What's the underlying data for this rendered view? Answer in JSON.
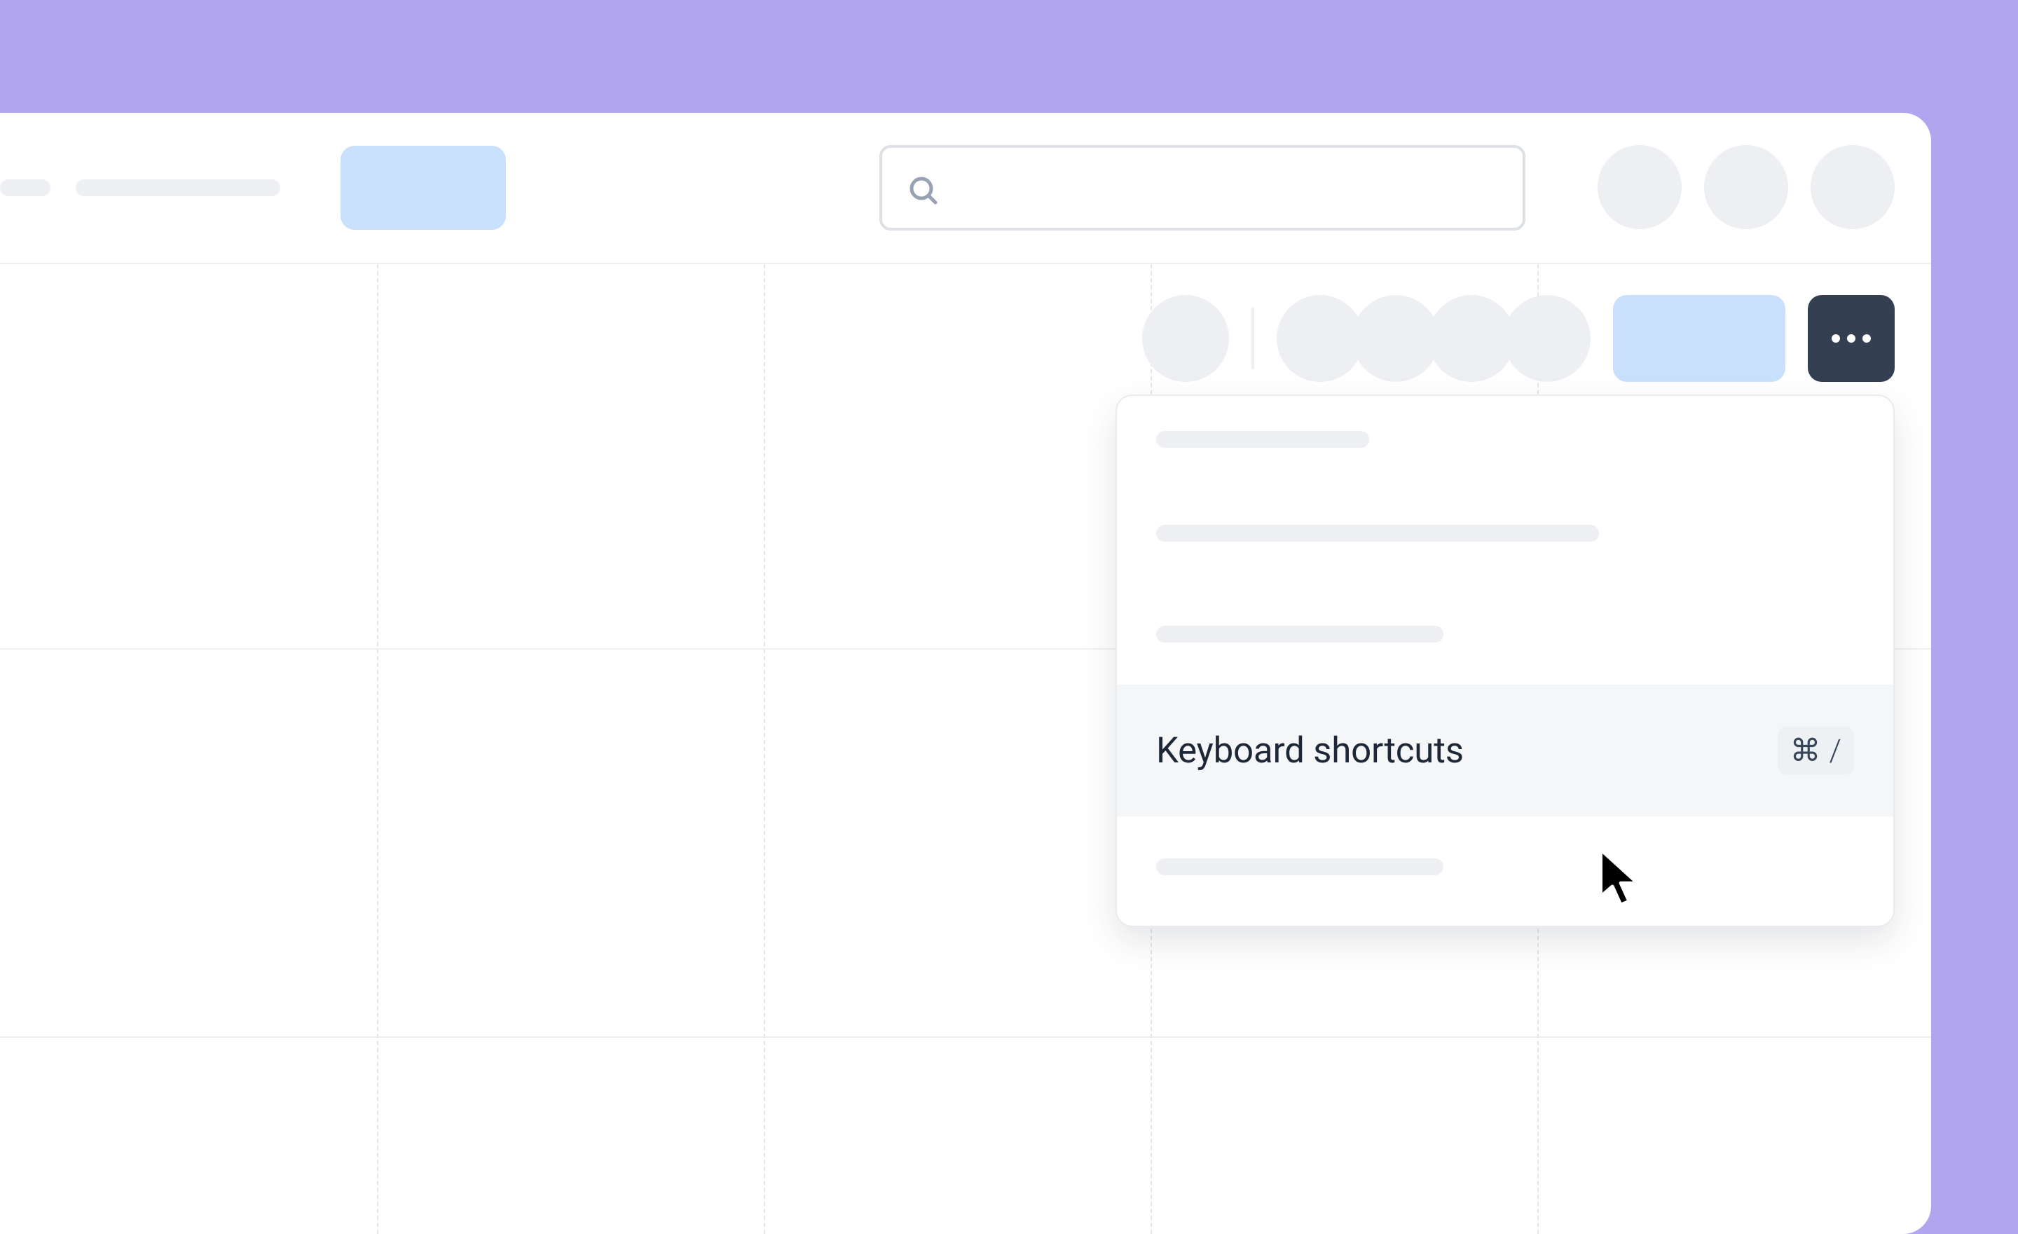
{
  "header": {
    "search_placeholder": ""
  },
  "toolbar": {
    "more_label": "More options"
  },
  "menu": {
    "items": {
      "keyboard_shortcuts": {
        "label": "Keyboard shortcuts",
        "shortcut_modifier": "⌘",
        "shortcut_key": "/"
      }
    }
  }
}
